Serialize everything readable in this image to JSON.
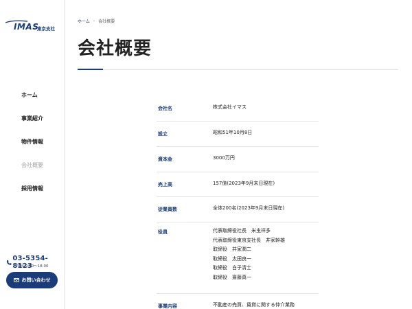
{
  "brand": {
    "logo_text": "IMAS",
    "branch": "東京支社",
    "accent": "#1a3c78"
  },
  "sidebar": {
    "items": [
      {
        "label": "ホーム",
        "active": false
      },
      {
        "label": "事業紹介",
        "active": false
      },
      {
        "label": "物件情報",
        "active": false
      },
      {
        "label": "会社概要",
        "active": true
      },
      {
        "label": "採用情報",
        "active": false
      }
    ],
    "phone": "03-5354-8123",
    "hours": "平日 9:00〜18:00",
    "contact_label": "お問い合わせ"
  },
  "breadcrumb": {
    "home": "ホーム",
    "separator": "›",
    "current": "会社概要"
  },
  "page_title": "会社概要",
  "company_info": {
    "rows": [
      {
        "label": "会社名",
        "lines": [
          "株式会社イマス"
        ]
      },
      {
        "label": "設立",
        "lines": [
          "昭和51年10月8日"
        ]
      },
      {
        "label": "資本金",
        "lines": [
          "3000万円"
        ]
      },
      {
        "label": "売上高",
        "lines": [
          "157億(2023年9月末日現在)"
        ]
      },
      {
        "label": "従業員数",
        "lines": [
          "全体200名(2023年9月末日現在)"
        ]
      },
      {
        "label": "役員",
        "lines": [
          "代表取締役社長　米虫祥多",
          "代表取締役東京支社長　井家幹雄",
          "取締役　井家潤二",
          "取締役　太田良一",
          "取締役　白子清士",
          "取締役　齋藤真一"
        ]
      },
      {
        "label": "事業内容",
        "lines": [
          "不動産の売買、賃貸に関する仲介業務"
        ]
      }
    ]
  }
}
